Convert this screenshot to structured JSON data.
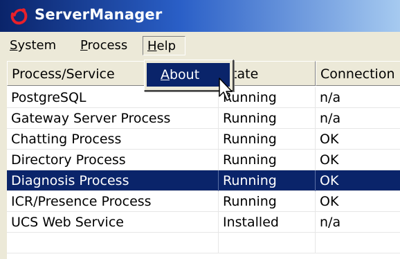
{
  "window": {
    "title": "ServerManager"
  },
  "menu": {
    "system": {
      "label_first": "S",
      "label_rest": "ystem"
    },
    "process": {
      "label_first": "P",
      "label_rest": "rocess"
    },
    "help": {
      "label_first": "H",
      "label_rest": "elp"
    }
  },
  "help_menu": {
    "about_first": "A",
    "about_rest": "bout"
  },
  "table": {
    "headers": [
      "Process/Service",
      "State",
      "Connection"
    ],
    "rows": [
      {
        "name": "PostgreSQL",
        "state": "Running",
        "connection": "n/a"
      },
      {
        "name": "Gateway Server Process",
        "state": "Running",
        "connection": "n/a"
      },
      {
        "name": "Chatting Process",
        "state": "Running",
        "connection": "OK"
      },
      {
        "name": "Directory Process",
        "state": "Running",
        "connection": "OK"
      },
      {
        "name": "Diagnosis Process",
        "state": "Running",
        "connection": "OK"
      },
      {
        "name": "ICR/Presence Process",
        "state": "Running",
        "connection": "OK"
      },
      {
        "name": "UCS Web Service",
        "state": "Installed",
        "connection": "n/a"
      }
    ]
  },
  "colors": {
    "selection": "#0a246a",
    "titlebar_start": "#0a246a",
    "titlebar_end": "#a6caf0"
  },
  "icons": {
    "app": "app-logo-icon",
    "cursor": "mouse-pointer-icon"
  }
}
